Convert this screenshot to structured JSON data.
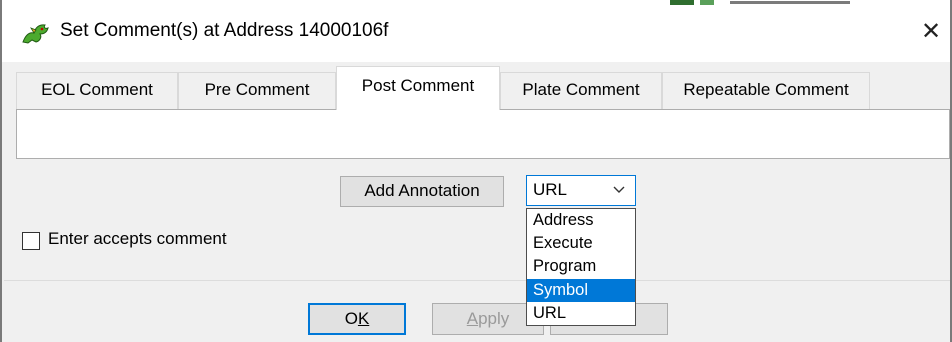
{
  "window": {
    "title": "Set Comment(s) at Address 14000106f",
    "close_glyph": "✕",
    "icon": "dragon-icon"
  },
  "tabs": [
    {
      "label": "EOL Comment",
      "active": false
    },
    {
      "label": "Pre Comment",
      "active": false
    },
    {
      "label": "Post Comment",
      "active": true
    },
    {
      "label": "Plate Comment",
      "active": false
    },
    {
      "label": "Repeatable Comment",
      "active": false
    }
  ],
  "comment": {
    "value": ""
  },
  "annotation": {
    "button_label": "Add Annotation",
    "selected": "URL",
    "options": [
      "Address",
      "Execute",
      "Program",
      "Symbol",
      "URL"
    ],
    "highlighted": "Symbol"
  },
  "enter_accepts": {
    "label": "Enter accepts comment",
    "checked": false
  },
  "footer": {
    "ok_prefix": "O",
    "ok_mnemonic": "K",
    "apply_mnemonic": "A",
    "apply_rest": "pply",
    "dismiss_visible_tail": "s"
  },
  "colors": {
    "accent": "#0078d7",
    "client_bg": "#f0f0f0",
    "button_bg": "#e1e1e1"
  }
}
